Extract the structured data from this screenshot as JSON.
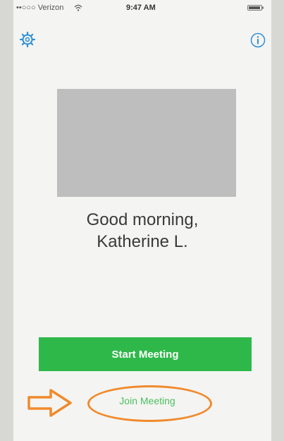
{
  "status_bar": {
    "carrier": "••○○○ Verizon",
    "time": "9:47 AM"
  },
  "greeting": {
    "line1": "Good morning,",
    "line2": "Katherine L."
  },
  "actions": {
    "start_label": "Start Meeting",
    "join_label": "Join Meeting"
  },
  "icons": {
    "settings": "gear-icon",
    "info": "info-icon",
    "wifi": "wifi-icon",
    "battery": "battery-icon",
    "annotation_arrow": "arrow-right-icon"
  },
  "colors": {
    "accent_blue": "#2f8fd8",
    "start_green": "#2fb84a",
    "join_green": "#4cbf60",
    "annotation_orange": "#f08a2c"
  }
}
